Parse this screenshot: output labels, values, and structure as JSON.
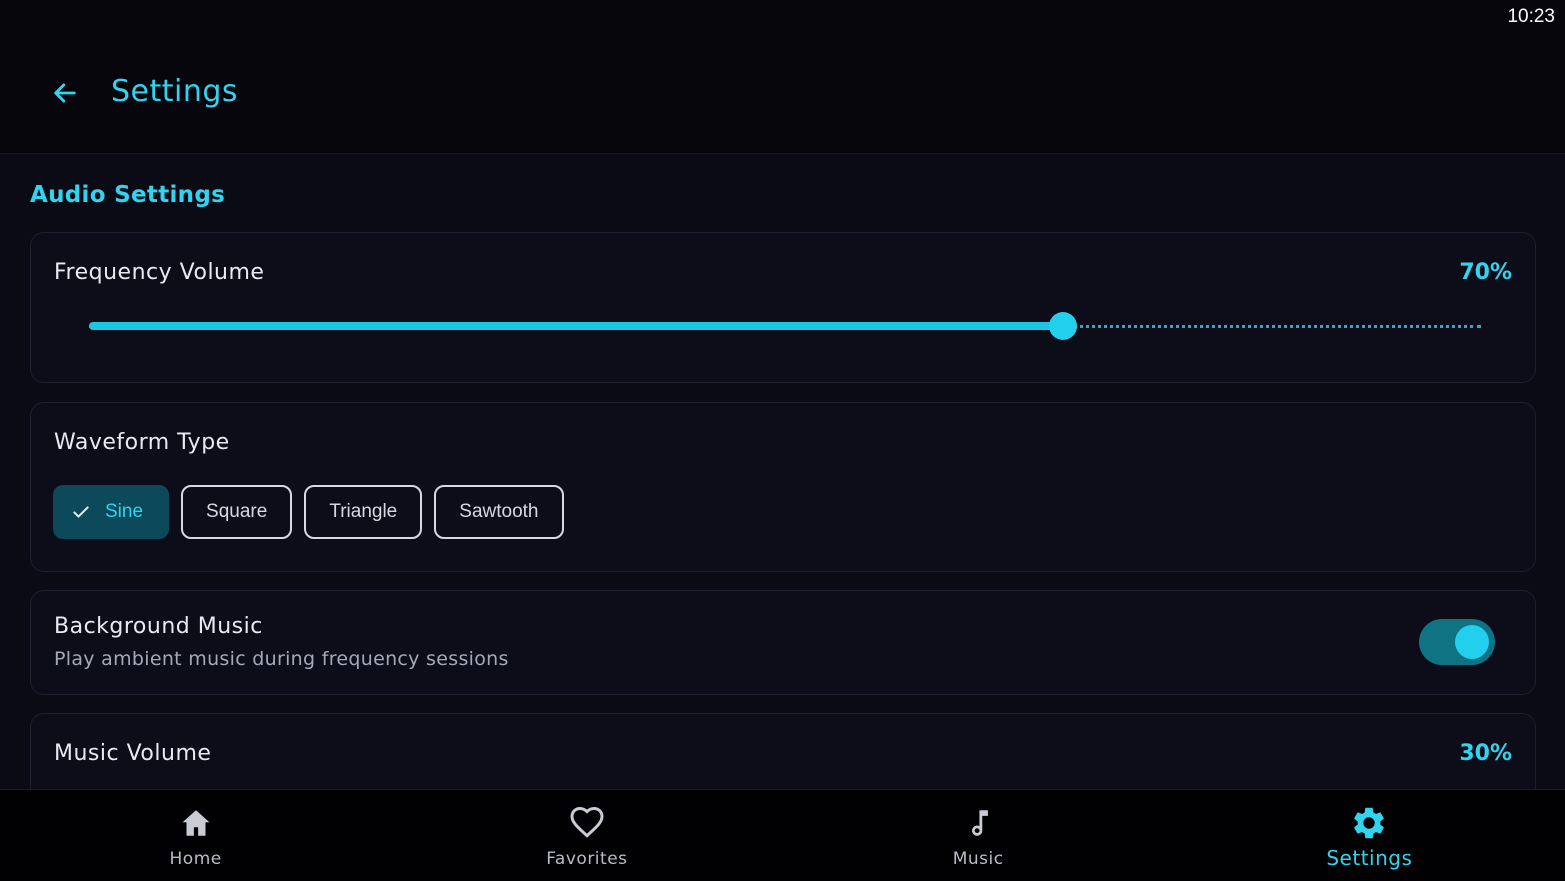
{
  "status_bar": {
    "time": "10:23"
  },
  "header": {
    "title": "Settings",
    "back_icon": "arrow-left-icon"
  },
  "section": {
    "title": "Audio Settings"
  },
  "frequency_volume": {
    "label": "Frequency Volume",
    "value_text": "70%",
    "value": 70
  },
  "waveform": {
    "label": "Waveform Type",
    "options": [
      "Sine",
      "Square",
      "Triangle",
      "Sawtooth"
    ],
    "selected": "Sine"
  },
  "background_music": {
    "label": "Background Music",
    "description": "Play ambient music during frequency sessions",
    "enabled": true
  },
  "music_volume": {
    "label": "Music Volume",
    "value_text": "30%",
    "value": 30
  },
  "bottom_nav": {
    "items": [
      {
        "label": "Home",
        "icon": "home-icon"
      },
      {
        "label": "Favorites",
        "icon": "heart-icon"
      },
      {
        "label": "Music",
        "icon": "music-note-icon"
      },
      {
        "label": "Settings",
        "icon": "gear-icon"
      }
    ],
    "active": "Settings"
  },
  "colors": {
    "accent": "#32d3ee",
    "background": "#0b0b16",
    "card": "#0d0d1a",
    "chip_selected": "#0c4a5b",
    "toggle_track": "#107384"
  }
}
